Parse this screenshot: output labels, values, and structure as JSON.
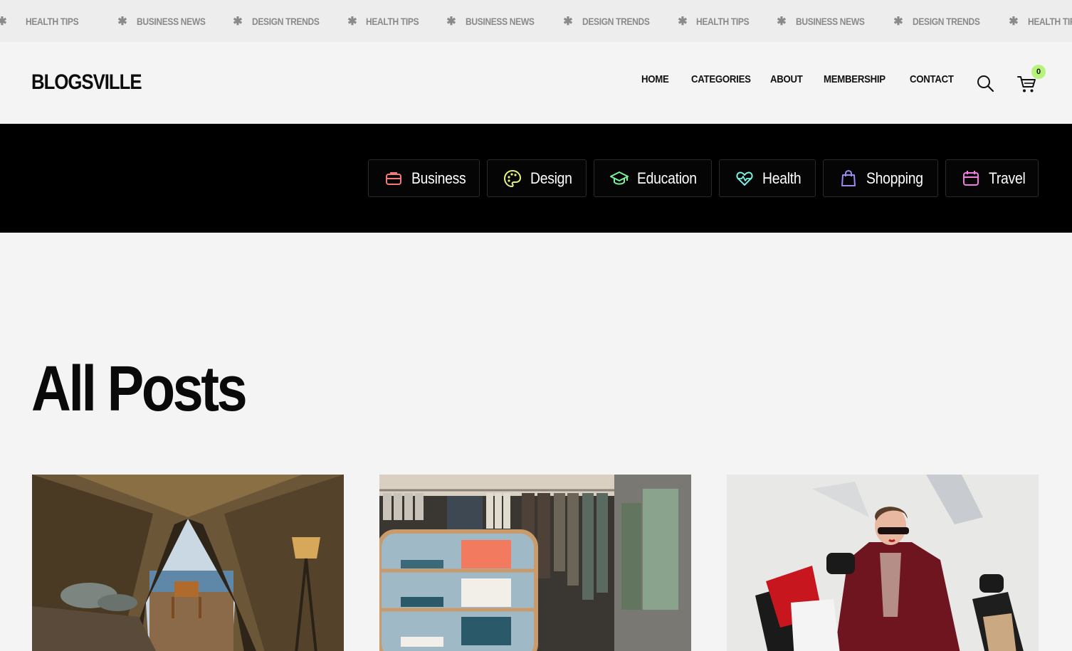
{
  "ticker": {
    "items": [
      "HEALTH TIPS",
      "BUSINESS NEWS",
      "DESIGN TRENDS",
      "HEALTH TIPS",
      "BUSINESS NEWS",
      "DESIGN TRENDS",
      "HEALTH TIPS",
      "BUSINESS NEWS",
      "DESIGN TRENDS",
      "HEALTH TIPS"
    ],
    "separator": "✱"
  },
  "header": {
    "logo": "BLOGSVILLE",
    "nav": [
      "HOME",
      "CATEGORIES",
      "ABOUT",
      "MEMBERSHIP",
      "CONTACT"
    ],
    "search_icon": "search-icon",
    "cart_icon": "cart-icon",
    "cart_count": "0",
    "badge_color": "#b7f27a"
  },
  "categories": [
    {
      "label": "Business",
      "icon": "briefcase-icon",
      "color": "#f27a7a"
    },
    {
      "label": "Design",
      "icon": "palette-icon",
      "color": "#e8f27a"
    },
    {
      "label": "Education",
      "icon": "graduation-cap-icon",
      "color": "#7af29a"
    },
    {
      "label": "Health",
      "icon": "heart-pulse-icon",
      "color": "#7af2e6"
    },
    {
      "label": "Shopping",
      "icon": "shopping-bag-icon",
      "color": "#9a8af2"
    },
    {
      "label": "Travel",
      "icon": "calendar-icon",
      "color": "#f27ae0"
    }
  ],
  "main": {
    "title": "All Posts",
    "posts": [
      {
        "image": "tent-beach-photo"
      },
      {
        "image": "clothing-store-photo"
      },
      {
        "image": "woman-shopping-bags-photo"
      }
    ]
  }
}
